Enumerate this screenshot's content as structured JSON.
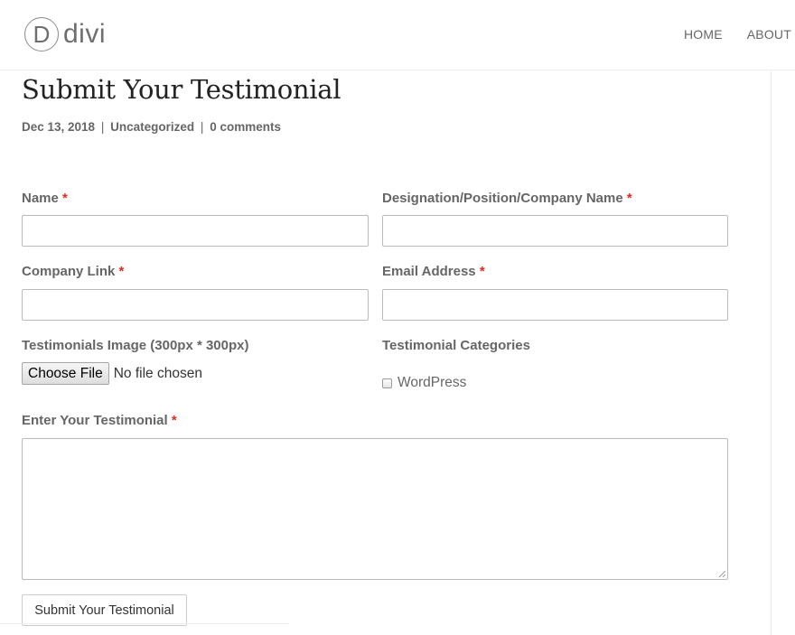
{
  "header": {
    "logo_letter": "D",
    "logo_word": "divi",
    "nav": [
      "HOME",
      "ABOUT"
    ]
  },
  "post": {
    "title": "Submit Your Testimonial",
    "meta": {
      "date": "Dec 13, 2018",
      "separator": "|",
      "category": "Uncategorized",
      "comments": "0 comments"
    }
  },
  "form": {
    "required_mark": "*",
    "name_label": "Name",
    "name_value": "",
    "designation_label": "Designation/Position/Company Name",
    "designation_value": "",
    "company_link_label": "Company Link",
    "company_link_value": "",
    "email_label": "Email Address",
    "email_value": "",
    "image_label": "Testimonials Image (300px * 300px)",
    "choose_file_label": "Choose File",
    "file_status": "No file chosen",
    "categories_label": "Testimonial Categories",
    "category_option": "WordPress",
    "category_checked": false,
    "testimonial_label": "Enter Your Testimonial",
    "testimonial_value": "",
    "submit_label": "Submit Your Testimonial"
  },
  "colors": {
    "required": "#e02b20",
    "label": "#666666",
    "title": "#222222"
  }
}
